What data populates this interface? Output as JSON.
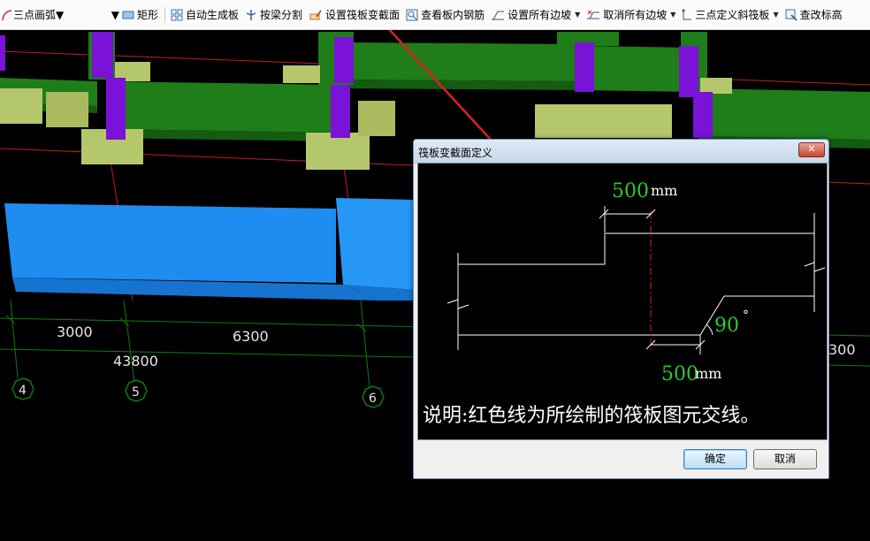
{
  "toolbar": {
    "arc_mode": "三点画弧",
    "rect": "矩形",
    "auto_board": "自动生成板",
    "split_beam": "按梁分割",
    "set_section": "设置筏板变截面",
    "view_rebar": "查看板内钢筋",
    "set_all_slopes": "设置所有边坡",
    "cancel_all_slopes": "取消所有边坡",
    "three_point_slope": "三点定义斜筏板",
    "check_elevation": "查改标高"
  },
  "viewport": {
    "dims": [
      "3000",
      "6300",
      "43800",
      "300"
    ],
    "axes": [
      "4",
      "5",
      "6"
    ],
    "colors": {
      "beam": "#1f7d1a",
      "column": "#7a12d8",
      "cap": "#b5c76b",
      "slab": "#1e8cf0",
      "grid": "#c41e1e",
      "dim": "#0f7a0f"
    }
  },
  "dialog": {
    "title": "筏板变截面定义",
    "top_dim_value": "500",
    "top_dim_unit": "mm",
    "angle_value": "90",
    "angle_unit": "°",
    "bottom_dim_value": "500",
    "bottom_dim_unit": "mm",
    "note": "说明:红色线为所绘制的筏板图元交线。",
    "ok": "确定",
    "cancel": "取消",
    "close": "✕"
  }
}
